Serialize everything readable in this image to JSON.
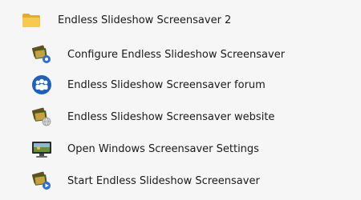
{
  "folder": {
    "label": "Endless Slideshow Screensaver 2",
    "icon": "folder-icon",
    "color": "#f2c14e"
  },
  "items": [
    {
      "label": "Configure Endless Slideshow Screensaver",
      "icon": "photo-gear-icon"
    },
    {
      "label": "Endless Slideshow Screensaver forum",
      "icon": "people-group-icon"
    },
    {
      "label": "Endless Slideshow Screensaver website",
      "icon": "photo-globe-icon"
    },
    {
      "label": "Open Windows Screensaver Settings",
      "icon": "monitor-icon"
    },
    {
      "label": "Start Endless Slideshow Screensaver",
      "icon": "photo-play-icon"
    }
  ]
}
